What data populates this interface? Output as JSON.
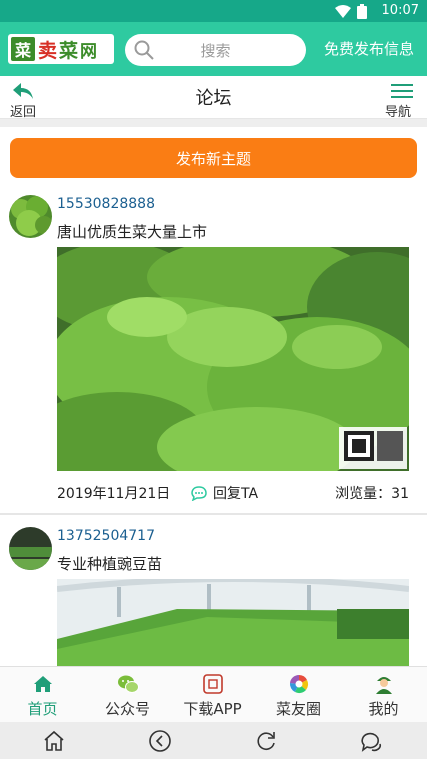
{
  "status_bar": {
    "time": "10:07"
  },
  "header": {
    "logo": {
      "mark": "菜",
      "text1": "卖",
      "text2": "菜",
      "text3": "网"
    },
    "search_placeholder": "搜索",
    "publish_free_label": "免费发布信息"
  },
  "subheader": {
    "back_label": "返回",
    "title": "论坛",
    "nav_label": "导航"
  },
  "new_topic_button": "发布新主题",
  "posts": [
    {
      "phone": "15530828888",
      "title": "唐山优质生菜大量上市",
      "date": "2019年11月21日",
      "reply_label": "回复TA",
      "views_label": "浏览量：",
      "views": "31"
    },
    {
      "phone": "13752504717",
      "title": "专业种植豌豆苗"
    }
  ],
  "tabbar": {
    "tabs": [
      {
        "label": "首页",
        "icon": "home-icon"
      },
      {
        "label": "公众号",
        "icon": "wechat-icon"
      },
      {
        "label": "下载APP",
        "icon": "download-app-icon"
      },
      {
        "label": "菜友圈",
        "icon": "moments-icon"
      },
      {
        "label": "我的",
        "icon": "profile-icon"
      }
    ],
    "active_color": "#1f9e78"
  },
  "colors": {
    "header_bg": "#2ecaa0",
    "status_bg": "#16a889",
    "accent_orange": "#fa7d14",
    "phone_link": "#1b5f90"
  }
}
